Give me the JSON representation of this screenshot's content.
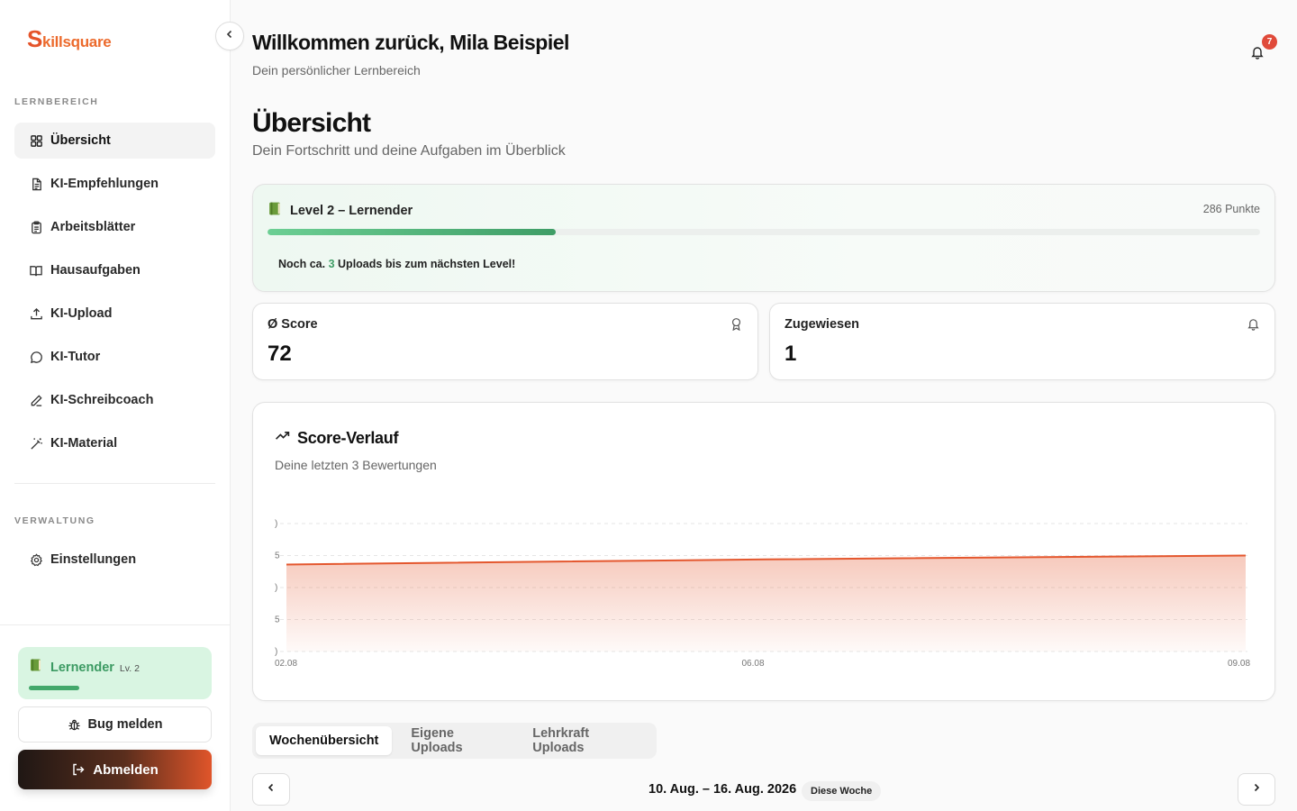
{
  "brand": {
    "logo_initial": "S",
    "logo_rest": "killsquare"
  },
  "sidebar": {
    "section_learning": "LERNBEREICH",
    "items": [
      {
        "label": "Übersicht",
        "icon": "grid-icon",
        "active": true
      },
      {
        "label": "KI-Empfehlungen",
        "icon": "document-icon"
      },
      {
        "label": "Arbeitsblätter",
        "icon": "clipboard-icon"
      },
      {
        "label": "Hausaufgaben",
        "icon": "book-icon"
      },
      {
        "label": "KI-Upload",
        "icon": "upload-icon"
      },
      {
        "label": "KI-Tutor",
        "icon": "chat-icon"
      },
      {
        "label": "KI-Schreibcoach",
        "icon": "pen-icon"
      },
      {
        "label": "KI-Material",
        "icon": "wand-icon"
      }
    ],
    "section_admin": "VERWALTUNG",
    "settings_label": "Einstellungen",
    "level_card": {
      "name": "Lernender",
      "level": "Lv. 2",
      "progress": 0.29
    },
    "bug_label": "Bug melden",
    "logout_label": "Abmelden"
  },
  "header": {
    "welcome": "Willkommen zurück, Mila Beispiel",
    "subtitle": "Dein persönlicher Lernbereich",
    "notifications": "7"
  },
  "page": {
    "title": "Übersicht",
    "subtitle": "Dein Fortschritt und deine Aufgaben im Überblick"
  },
  "level": {
    "title": "Level 2 – Lernender",
    "points": "286 Punkte",
    "progress": 0.29,
    "hint_prefix": "Noch ca.",
    "hint_num": "3",
    "hint_suffix": "Uploads bis zum nächsten Level!"
  },
  "stats": {
    "score_label": "Ø Score",
    "score_value": "72",
    "assigned_label": "Zugewiesen",
    "assigned_value": "1"
  },
  "chart": {
    "title": "Score-Verlauf",
    "subtitle": "Deine letzten 3 Bewertungen"
  },
  "chart_data": {
    "type": "area",
    "x": [
      "02.08",
      "06.08",
      "09.08"
    ],
    "values": [
      68,
      72,
      75
    ],
    "ylim": [
      0,
      100
    ],
    "yticks": [
      0,
      25,
      50,
      75,
      100
    ],
    "ytick_labels": [
      ")",
      "5",
      ")",
      "5",
      ")"
    ],
    "grid": true,
    "line_color": "#e4572e",
    "title": "Score-Verlauf"
  },
  "tabs": [
    {
      "label": "Wochenübersicht",
      "active": true
    },
    {
      "label": "Eigene Uploads"
    },
    {
      "label": "Lehrkraft Uploads"
    }
  ],
  "week": {
    "range": "10. Aug. – 16. Aug. 2026",
    "chip": "Diese Woche"
  },
  "colors": {
    "accent": "#e4572e",
    "green": "#3f9d66",
    "badge": "#e04a3a"
  }
}
